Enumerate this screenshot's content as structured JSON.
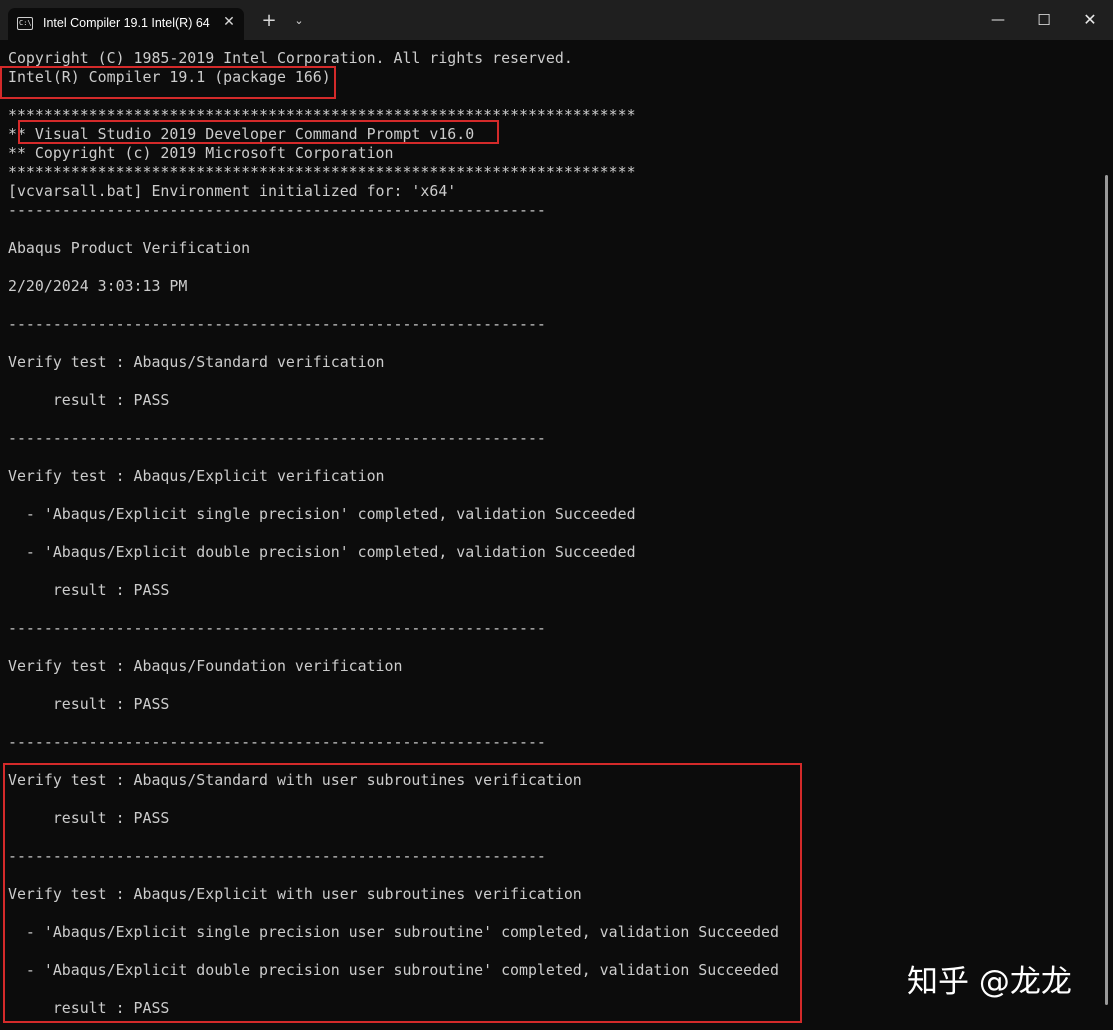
{
  "window": {
    "tab_title": "Intel Compiler 19.1 Intel(R) 64",
    "tab_icon_text": "C:\\",
    "close_tab_glyph": "✕",
    "new_tab_glyph": "+",
    "dropdown_glyph": "⌄",
    "minimize_glyph": "—",
    "maximize_glyph": "☐",
    "close_glyph": "✕"
  },
  "terminal": {
    "lines": [
      "Copyright (C) 1985-2019 Intel Corporation. All rights reserved.",
      "Intel(R) Compiler 19.1 (package 166)",
      "",
      "**********************************************************************",
      "** Visual Studio 2019 Developer Command Prompt v16.0",
      "** Copyright (c) 2019 Microsoft Corporation",
      "**********************************************************************",
      "[vcvarsall.bat] Environment initialized for: 'x64'",
      "------------------------------------------------------------",
      "",
      "Abaqus Product Verification",
      "",
      "2/20/2024 3:03:13 PM",
      "",
      "------------------------------------------------------------",
      "",
      "Verify test : Abaqus/Standard verification",
      "",
      "     result : PASS",
      "",
      "------------------------------------------------------------",
      "",
      "Verify test : Abaqus/Explicit verification",
      "",
      "  - 'Abaqus/Explicit single precision' completed, validation Succeeded",
      "",
      "  - 'Abaqus/Explicit double precision' completed, validation Succeeded",
      "",
      "     result : PASS",
      "",
      "------------------------------------------------------------",
      "",
      "Verify test : Abaqus/Foundation verification",
      "",
      "     result : PASS",
      "",
      "------------------------------------------------------------",
      "",
      "Verify test : Abaqus/Standard with user subroutines verification",
      "",
      "     result : PASS",
      "",
      "------------------------------------------------------------",
      "",
      "Verify test : Abaqus/Explicit with user subroutines verification",
      "",
      "  - 'Abaqus/Explicit single precision user subroutine' completed, validation Succeeded",
      "",
      "  - 'Abaqus/Explicit double precision user subroutine' completed, validation Succeeded",
      "",
      "     result : PASS"
    ]
  },
  "watermark": "知乎 @龙龙",
  "colors": {
    "background": "#0c0c0c",
    "titlebar": "#1f1f1f",
    "text": "#cccccc",
    "highlight": "#d42a2a"
  }
}
